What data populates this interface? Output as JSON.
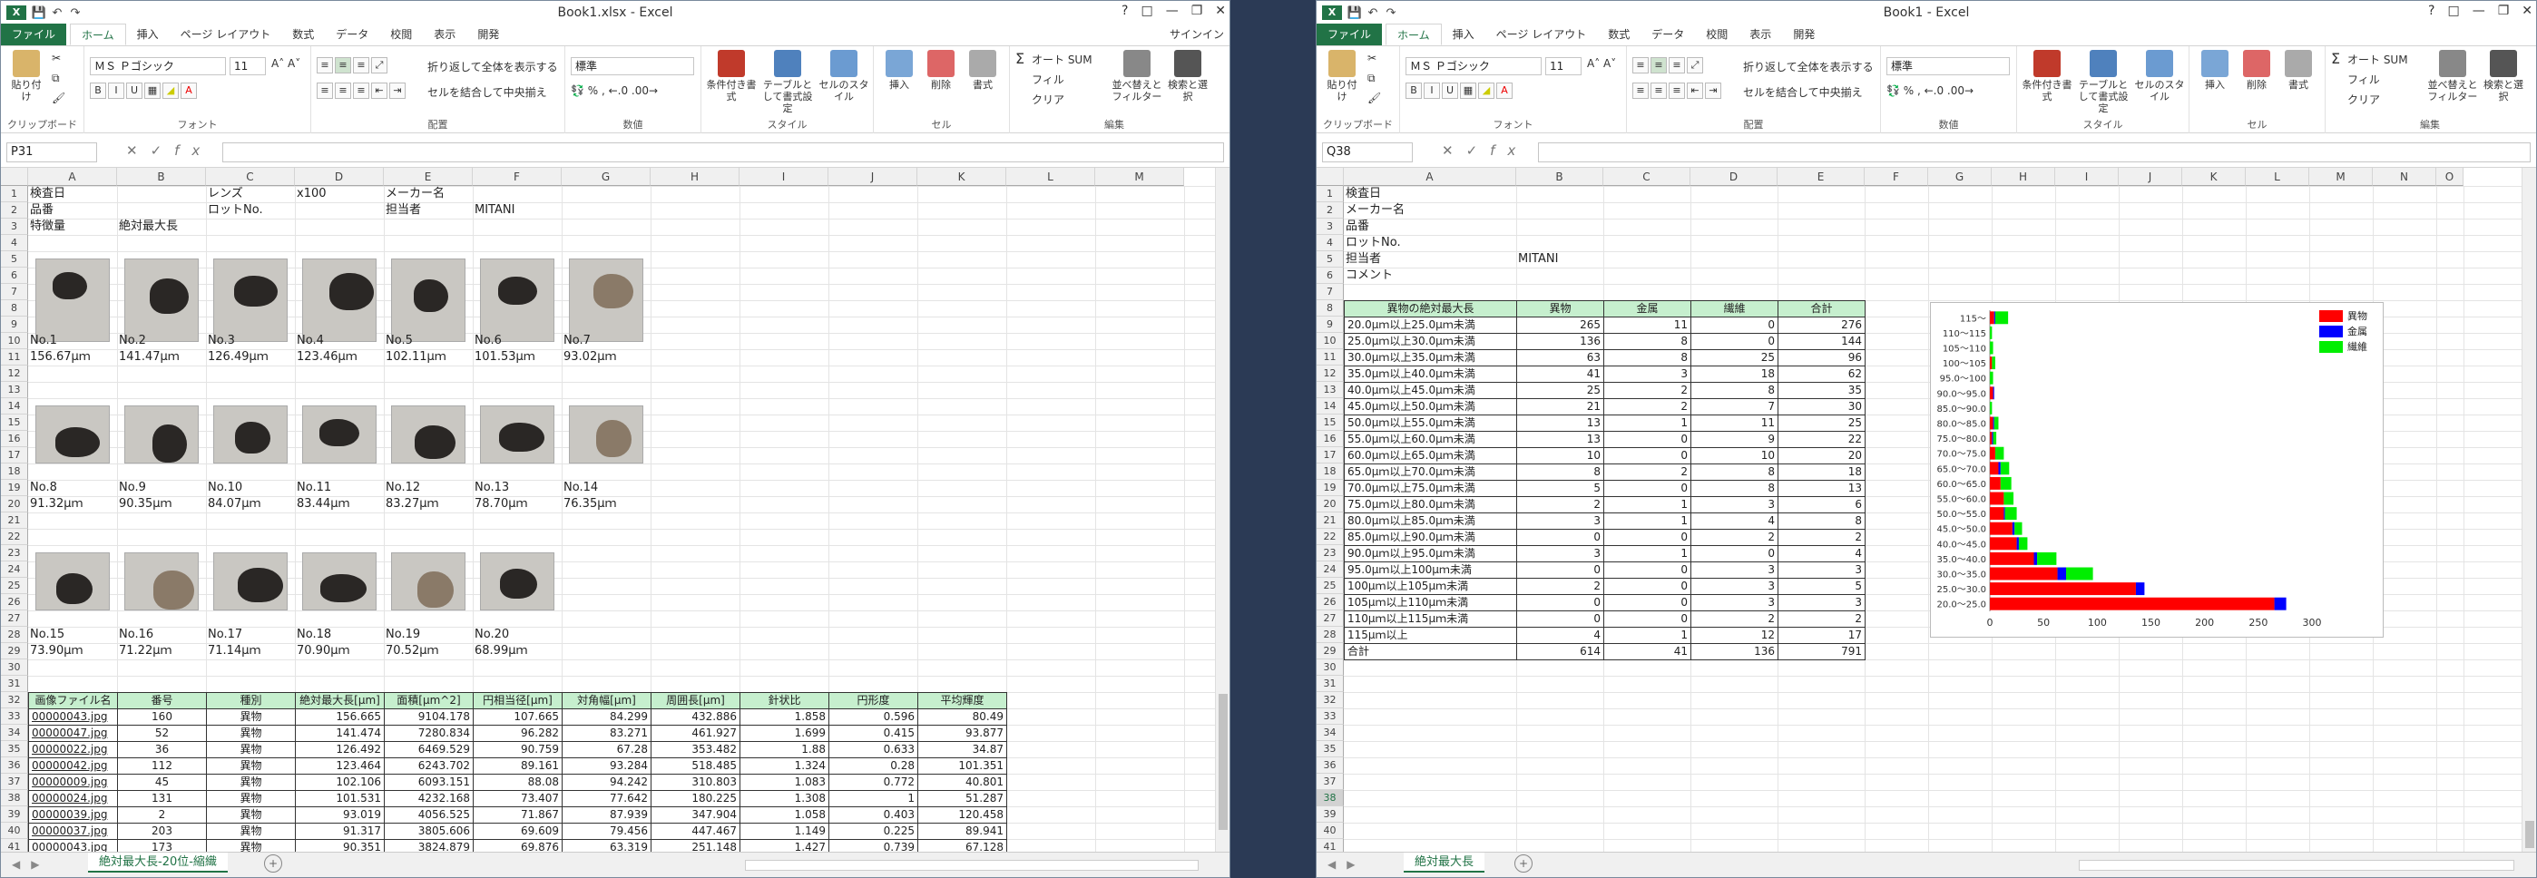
{
  "left": {
    "title": "Book1.xlsx - Excel",
    "file_tab": "ファイル",
    "tabs": [
      "ホーム",
      "挿入",
      "ページ レイアウト",
      "数式",
      "データ",
      "校閲",
      "表示",
      "開発"
    ],
    "signin": "サインイン",
    "ribbon": {
      "paste": "貼り付け",
      "clipboard": "クリップボード",
      "font_name": "ＭＳ Ｐゴシック",
      "font_size": "11",
      "font": "フォント",
      "wrap": "折り返して全体を表示する",
      "merge": "セルを結合して中央揃え",
      "alignment": "配置",
      "number_format": "標準",
      "number": "数値",
      "cond": "条件付き書式",
      "table": "テーブルとして書式設定",
      "cellstyle": "セルのスタイル",
      "styles": "スタイル",
      "insert": "挿入",
      "delete": "削除",
      "format": "書式",
      "cells": "セル",
      "autosum": "オート SUM",
      "fill": "フィル",
      "clear": "クリア",
      "sort": "並べ替えとフィルター",
      "find": "検索と選択",
      "editing": "編集"
    },
    "namebox": "P31",
    "columns": [
      "A",
      "B",
      "C",
      "D",
      "E",
      "F",
      "G",
      "H",
      "I",
      "J",
      "K",
      "L",
      "M"
    ],
    "rows": [
      "1",
      "2",
      "3",
      "4",
      "5",
      "6",
      "7",
      "8",
      "9",
      "10",
      "11",
      "12",
      "13",
      "14",
      "15",
      "16",
      "17",
      "18",
      "19",
      "20",
      "21",
      "22",
      "23",
      "24",
      "25",
      "26",
      "27",
      "28",
      "29",
      "30",
      "31",
      "32",
      "33",
      "34",
      "35",
      "36",
      "37",
      "38",
      "39",
      "40",
      "41"
    ],
    "header_cells": {
      "a1": "検査日",
      "c1": "レンズ",
      "d1": "x100",
      "e1": "メーカー名",
      "a2": "品番",
      "c2": "ロットNo.",
      "e2": "担当者",
      "f2": "MITANI",
      "a3": "特徴量",
      "b3": "絶対最大長"
    },
    "photo_rows": [
      {
        "labels": [
          "No.1",
          "No.2",
          "No.3",
          "No.4",
          "No.5",
          "No.6",
          "No.7"
        ],
        "values": [
          "156.67μｍ",
          "141.47μｍ",
          "126.49μｍ",
          "123.46μｍ",
          "102.11μｍ",
          "101.53μｍ",
          "93.02μｍ"
        ]
      },
      {
        "labels": [
          "No.8",
          "No.9",
          "No.10",
          "No.11",
          "No.12",
          "No.13",
          "No.14"
        ],
        "values": [
          "91.32μｍ",
          "90.35μｍ",
          "84.07μｍ",
          "83.44μｍ",
          "83.27μｍ",
          "78.70μｍ",
          "76.35μｍ"
        ]
      },
      {
        "labels": [
          "No.15",
          "No.16",
          "No.17",
          "No.18",
          "No.19",
          "No.20"
        ],
        "values": [
          "73.90μｍ",
          "71.22μｍ",
          "71.14μｍ",
          "70.90μｍ",
          "70.52μｍ",
          "68.99μｍ"
        ]
      }
    ],
    "table": {
      "headers": [
        "画像ファイル名",
        "番号",
        "種別",
        "絶対最大長[μm]",
        "面積[μm^2]",
        "円相当径[μm]",
        "対角幅[μm]",
        "周囲長[μm]",
        "針状比",
        "円形度",
        "平均輝度"
      ],
      "rows": [
        [
          "00000043.jpg",
          "160",
          "異物",
          "156.665",
          "9104.178",
          "107.665",
          "84.299",
          "432.886",
          "1.858",
          "0.596",
          "80.49"
        ],
        [
          "00000047.jpg",
          "52",
          "異物",
          "141.474",
          "7280.834",
          "96.282",
          "83.271",
          "461.927",
          "1.699",
          "0.415",
          "93.877"
        ],
        [
          "00000022.jpg",
          "36",
          "異物",
          "126.492",
          "6469.529",
          "90.759",
          "67.28",
          "353.482",
          "1.88",
          "0.633",
          "34.87"
        ],
        [
          "00000042.jpg",
          "112",
          "異物",
          "123.464",
          "6243.702",
          "89.161",
          "93.284",
          "518.485",
          "1.324",
          "0.28",
          "101.351"
        ],
        [
          "00000009.jpg",
          "45",
          "異物",
          "102.106",
          "6093.151",
          "88.08",
          "94.242",
          "310.803",
          "1.083",
          "0.772",
          "40.801"
        ],
        [
          "00000024.jpg",
          "131",
          "異物",
          "101.531",
          "4232.168",
          "73.407",
          "77.642",
          "180.225",
          "1.308",
          "1",
          "51.287"
        ],
        [
          "00000039.jpg",
          "2",
          "異物",
          "93.019",
          "4056.525",
          "71.867",
          "87.939",
          "347.904",
          "1.058",
          "0.403",
          "120.458"
        ],
        [
          "00000037.jpg",
          "203",
          "異物",
          "91.317",
          "3805.606",
          "69.609",
          "79.456",
          "447.467",
          "1.149",
          "0.225",
          "89.941"
        ],
        [
          "00000043.jpg",
          "173",
          "異物",
          "90.351",
          "3824.879",
          "69.876",
          "63.319",
          "251.148",
          "1.427",
          "0.739",
          "67.128"
        ]
      ]
    },
    "sheet_tab": "絶対最大長-20位-縮織"
  },
  "right": {
    "title": "Book1 - Excel",
    "namebox": "Q38",
    "columns": [
      "A",
      "B",
      "C",
      "D",
      "E",
      "F",
      "G",
      "H",
      "I",
      "J",
      "K",
      "L",
      "M",
      "N",
      "O"
    ],
    "rows": [
      "1",
      "2",
      "3",
      "4",
      "5",
      "6",
      "7",
      "8",
      "9",
      "10",
      "11",
      "12",
      "13",
      "14",
      "15",
      "16",
      "17",
      "18",
      "19",
      "20",
      "21",
      "22",
      "23",
      "24",
      "25",
      "26",
      "27",
      "28",
      "29",
      "30",
      "31",
      "32",
      "33",
      "34",
      "35",
      "36",
      "37",
      "38",
      "39",
      "40",
      "41"
    ],
    "info": [
      "検査日",
      "メーカー名",
      "品番",
      "ロットNo.",
      "担当者",
      "コメント"
    ],
    "tantou": "MITANI",
    "table": {
      "headers": [
        "異物の絶対最大長",
        "異物",
        "金属",
        "繊維",
        "合計"
      ],
      "rows": [
        [
          "20.0μｍ以上25.0μｍ未満",
          "265",
          "11",
          "0",
          "276"
        ],
        [
          "25.0μｍ以上30.0μｍ未満",
          "136",
          "8",
          "0",
          "144"
        ],
        [
          "30.0μｍ以上35.0μｍ未満",
          "63",
          "8",
          "25",
          "96"
        ],
        [
          "35.0μｍ以上40.0μｍ未満",
          "41",
          "3",
          "18",
          "62"
        ],
        [
          "40.0μｍ以上45.0μｍ未満",
          "25",
          "2",
          "8",
          "35"
        ],
        [
          "45.0μｍ以上50.0μｍ未満",
          "21",
          "2",
          "7",
          "30"
        ],
        [
          "50.0μｍ以上55.0μｍ未満",
          "13",
          "1",
          "11",
          "25"
        ],
        [
          "55.0μｍ以上60.0μｍ未満",
          "13",
          "0",
          "9",
          "22"
        ],
        [
          "60.0μｍ以上65.0μｍ未満",
          "10",
          "0",
          "10",
          "20"
        ],
        [
          "65.0μｍ以上70.0μｍ未満",
          "8",
          "2",
          "8",
          "18"
        ],
        [
          "70.0μｍ以上75.0μｍ未満",
          "5",
          "0",
          "8",
          "13"
        ],
        [
          "75.0μｍ以上80.0μｍ未満",
          "2",
          "1",
          "3",
          "6"
        ],
        [
          "80.0μｍ以上85.0μｍ未満",
          "3",
          "1",
          "4",
          "8"
        ],
        [
          "85.0μｍ以上90.0μｍ未満",
          "0",
          "0",
          "2",
          "2"
        ],
        [
          "90.0μｍ以上95.0μｍ未満",
          "3",
          "1",
          "0",
          "4"
        ],
        [
          "95.0μｍ以上100μｍ未満",
          "0",
          "0",
          "3",
          "3"
        ],
        [
          "100μｍ以上105μｍ未満",
          "2",
          "0",
          "3",
          "5"
        ],
        [
          "105μｍ以上110μｍ未満",
          "0",
          "0",
          "3",
          "3"
        ],
        [
          "110μｍ以上115μｍ未満",
          "0",
          "0",
          "2",
          "2"
        ],
        [
          "115μｍ以上",
          "4",
          "1",
          "12",
          "17"
        ]
      ],
      "total": [
        "合計",
        "614",
        "41",
        "136",
        "791"
      ]
    },
    "sheet_tab": "絶対最大長"
  },
  "chart_data": {
    "type": "bar",
    "orientation": "horizontal",
    "stacked": true,
    "categories": [
      "20.0～25.0",
      "25.0～30.0",
      "30.0～35.0",
      "35.0～40.0",
      "40.0～45.0",
      "45.0～50.0",
      "50.0～55.0",
      "55.0～60.0",
      "60.0～65.0",
      "65.0～70.0",
      "70.0～75.0",
      "75.0～80.0",
      "80.0～85.0",
      "85.0～90.0",
      "90.0～95.0",
      "95.0～100",
      "100～105",
      "105～110",
      "110～115",
      "115～"
    ],
    "series": [
      {
        "name": "異物",
        "color": "#ff0000",
        "values": [
          265,
          136,
          63,
          41,
          25,
          21,
          13,
          13,
          10,
          8,
          5,
          2,
          3,
          0,
          3,
          0,
          2,
          0,
          0,
          4
        ]
      },
      {
        "name": "金属",
        "color": "#0000ff",
        "values": [
          11,
          8,
          8,
          3,
          2,
          2,
          1,
          0,
          0,
          2,
          0,
          1,
          1,
          0,
          1,
          0,
          0,
          0,
          0,
          1
        ]
      },
      {
        "name": "繊維",
        "color": "#00ee00",
        "values": [
          0,
          0,
          25,
          18,
          8,
          7,
          11,
          9,
          10,
          8,
          8,
          3,
          4,
          2,
          0,
          3,
          3,
          3,
          2,
          12
        ]
      }
    ],
    "xticks": [
      "0",
      "50",
      "100",
      "150",
      "200",
      "250",
      "300"
    ],
    "xlim": [
      0,
      300
    ],
    "legend_position": "top-right"
  }
}
